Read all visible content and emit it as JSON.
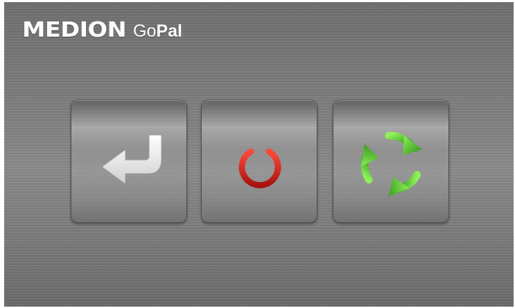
{
  "header": {
    "brand_name": "MEDION",
    "product_prefix": "Go",
    "product_suffix": "Pal"
  },
  "buttons": [
    {
      "id": "back",
      "icon": "return-arrow-icon",
      "color": "#f2f2f2"
    },
    {
      "id": "power",
      "icon": "power-icon",
      "color": "#d0231c"
    },
    {
      "id": "restart",
      "icon": "recycle-arrows-icon",
      "color": "#4cbf2a"
    }
  ],
  "colors": {
    "background": "#7a7a7a",
    "button_face": "#909090",
    "brand_text": "#ffffff"
  }
}
